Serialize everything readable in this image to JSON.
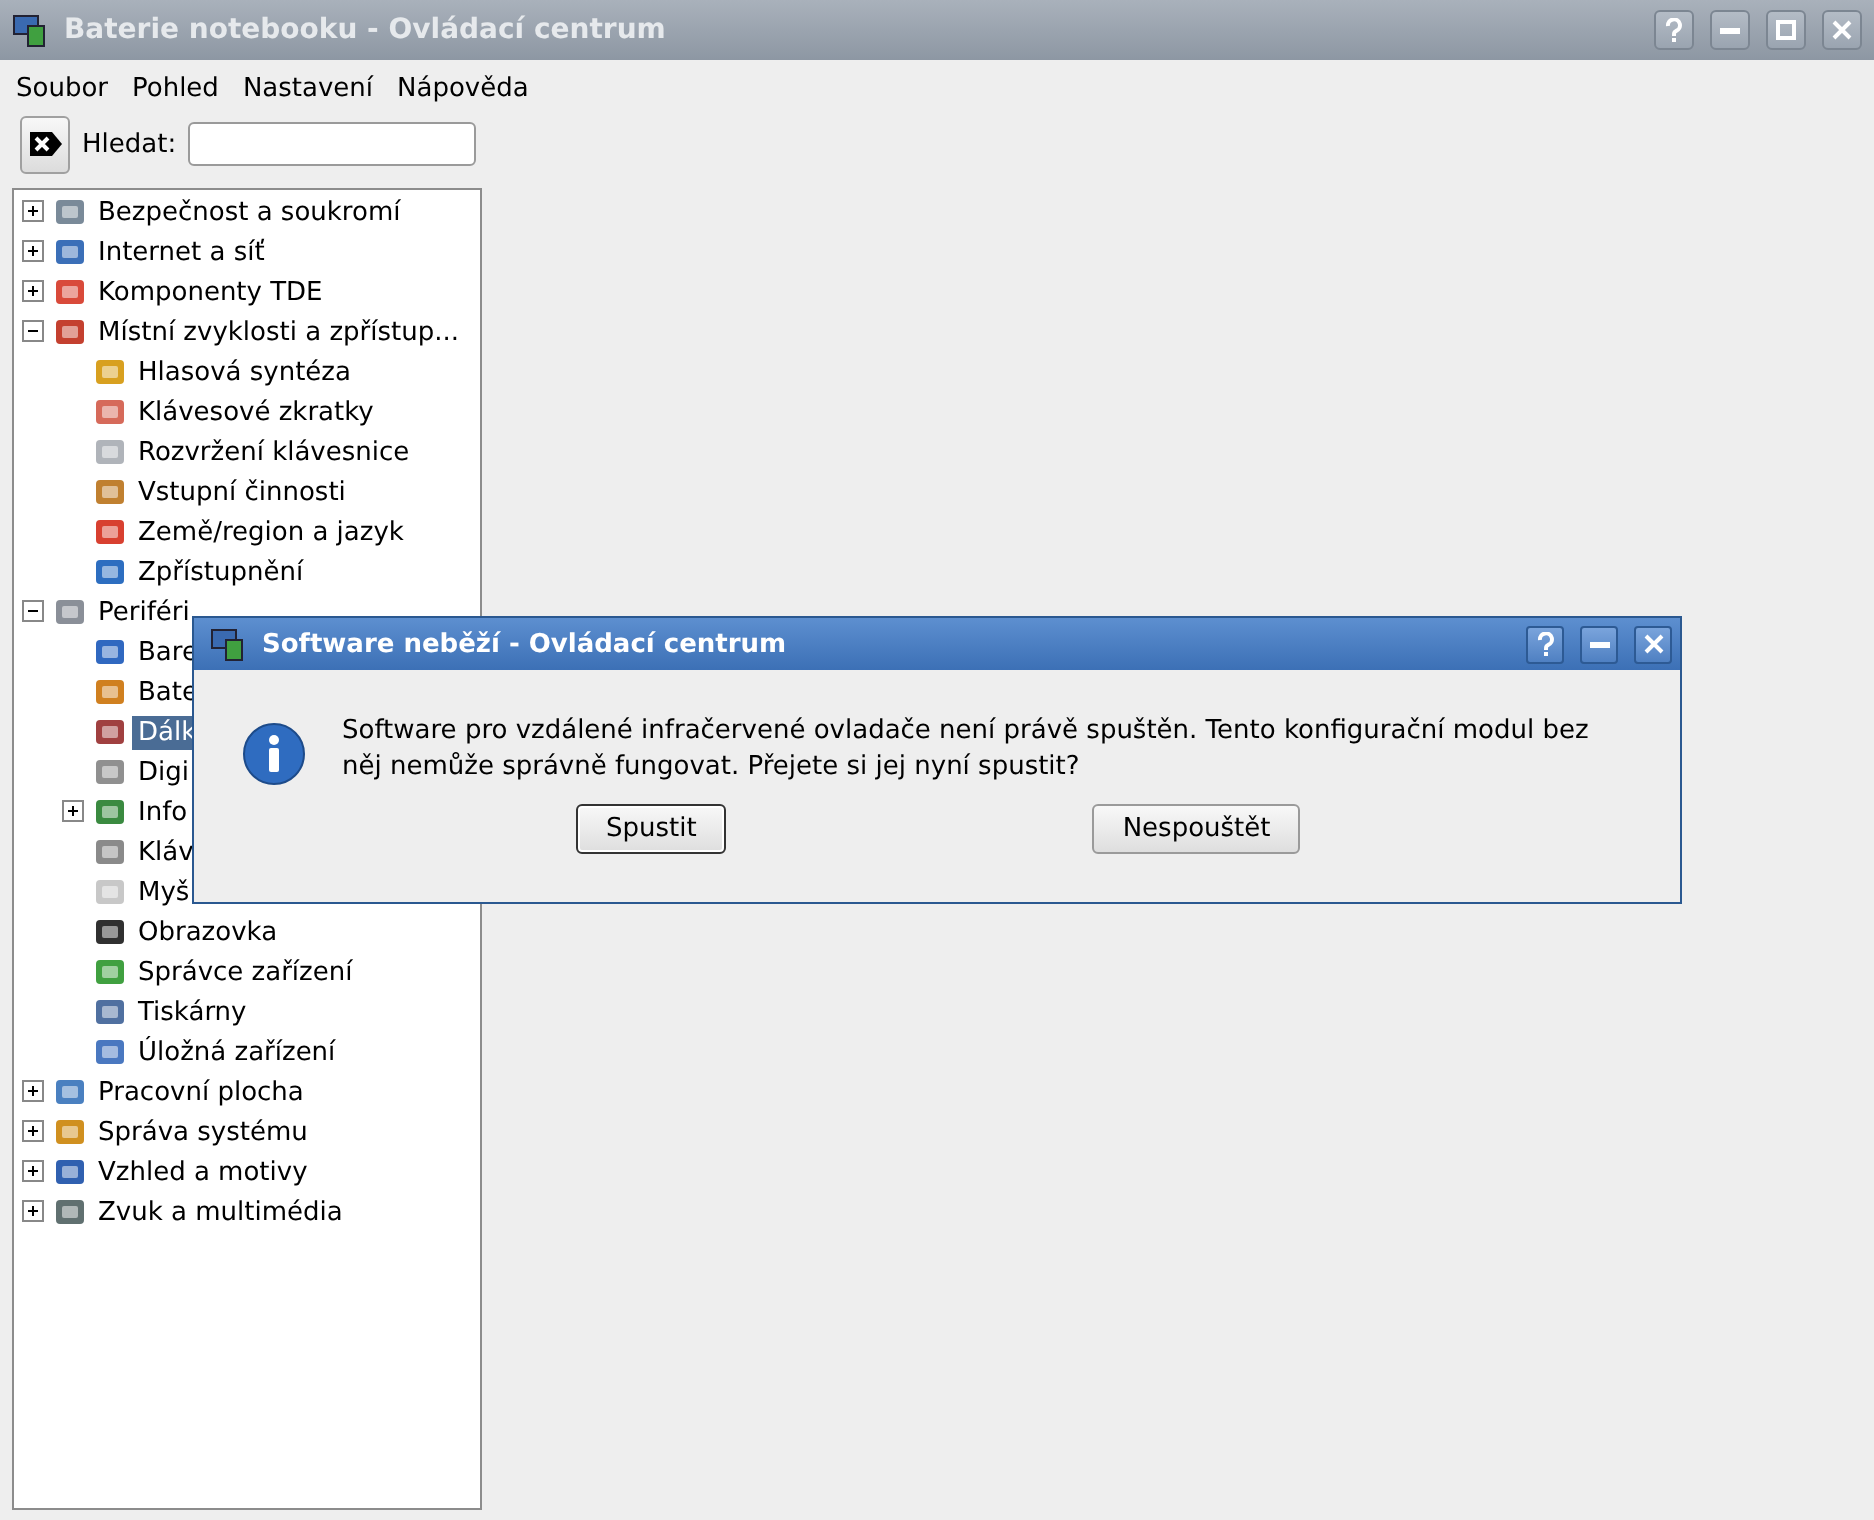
{
  "window": {
    "title": "Baterie notebooku - Ovládací centrum"
  },
  "menu": [
    {
      "label": "Soubor"
    },
    {
      "label": "Pohled"
    },
    {
      "label": "Nastavení"
    },
    {
      "label": "Nápověda"
    }
  ],
  "search": {
    "label": "Hledat:"
  },
  "tree": [
    {
      "label": "Bezpečnost a soukromí",
      "kind": "folder",
      "expanded": false,
      "selected": false
    },
    {
      "label": "Internet a síť",
      "kind": "folder",
      "expanded": false,
      "selected": false
    },
    {
      "label": "Komponenty TDE",
      "kind": "folder",
      "expanded": false,
      "selected": false
    },
    {
      "label": "Místní zvyklosti a zpřístup...",
      "kind": "folder",
      "expanded": true,
      "selected": false,
      "children": [
        {
          "label": "Hlasová syntéza",
          "kind": "module",
          "selected": false
        },
        {
          "label": "Klávesové zkratky",
          "kind": "module",
          "selected": false
        },
        {
          "label": "Rozvržení klávesnice",
          "kind": "module",
          "selected": false
        },
        {
          "label": "Vstupní činnosti",
          "kind": "module",
          "selected": false
        },
        {
          "label": "Země/region a jazyk",
          "kind": "module",
          "selected": false
        },
        {
          "label": "Zpřístupnění",
          "kind": "module",
          "selected": false
        }
      ]
    },
    {
      "label": "Periféri",
      "kind": "folder",
      "expanded": true,
      "selected": false,
      "children": [
        {
          "label": "Bare",
          "kind": "module",
          "selected": false
        },
        {
          "label": "Bate",
          "kind": "module",
          "selected": false
        },
        {
          "label": "Dálk",
          "kind": "module",
          "selected": true
        },
        {
          "label": "Digi",
          "kind": "module",
          "selected": false
        },
        {
          "label": "Info",
          "kind": "folder",
          "expanded": false,
          "selected": false
        },
        {
          "label": "Kláv",
          "kind": "module",
          "selected": false
        },
        {
          "label": "Myš",
          "kind": "module",
          "selected": false
        },
        {
          "label": "Obrazovka",
          "kind": "module",
          "selected": false
        },
        {
          "label": "Správce zařízení",
          "kind": "module",
          "selected": false
        },
        {
          "label": "Tiskárny",
          "kind": "module",
          "selected": false
        },
        {
          "label": "Úložná zařízení",
          "kind": "module",
          "selected": false
        }
      ]
    },
    {
      "label": "Pracovní plocha",
      "kind": "folder",
      "expanded": false,
      "selected": false
    },
    {
      "label": "Správa systému",
      "kind": "folder",
      "expanded": false,
      "selected": false
    },
    {
      "label": "Vzhled a motivy",
      "kind": "folder",
      "expanded": false,
      "selected": false
    },
    {
      "label": "Zvuk a multimédia",
      "kind": "folder",
      "expanded": false,
      "selected": false
    }
  ],
  "dialog": {
    "title": "Software neběží - Ovládací centrum",
    "message": "Software pro vzdálené infračervené ovladače není právě spuštěn. Tento konfigurační modul bez něj nemůže správně fungovat. Přejete si jej nyní spustit?",
    "buttons": [
      {
        "label": "Spustit",
        "default": true
      },
      {
        "label": "Nespouštět",
        "default": false
      }
    ]
  }
}
